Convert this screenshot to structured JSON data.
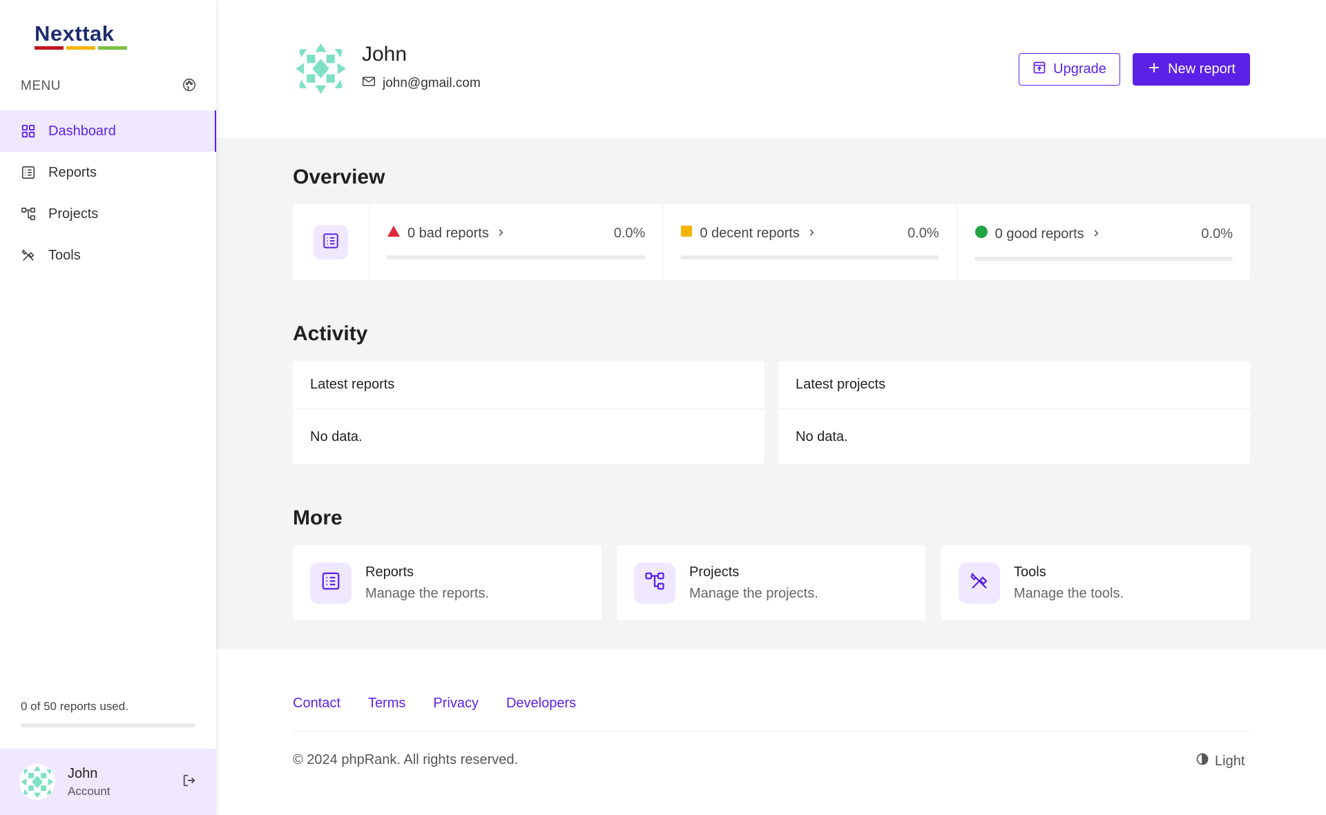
{
  "brand": {
    "logo_text": "Nexttak",
    "logo_colors": [
      "#c0161d",
      "#f1b400",
      "#7ac142"
    ]
  },
  "sidebar": {
    "menu_title": "MENU",
    "menu_icon": "palette-icon",
    "items": [
      {
        "label": "Dashboard",
        "icon": "grid-icon",
        "active": true
      },
      {
        "label": "Reports",
        "icon": "list-icon",
        "active": false
      },
      {
        "label": "Projects",
        "icon": "hierarchy-icon",
        "active": false
      },
      {
        "label": "Tools",
        "icon": "tools-icon",
        "active": false
      }
    ],
    "usage_text": "0 of 50 reports used.",
    "usage_fraction": 0,
    "account": {
      "name": "John",
      "sub": "Account",
      "logout_icon": "logout-icon"
    }
  },
  "header": {
    "name": "John",
    "email": "john@gmail.com",
    "upgrade_label": "Upgrade",
    "new_report_label": "New report"
  },
  "overview": {
    "title": "Overview",
    "stats": [
      {
        "label": "0 bad reports",
        "percent": "0.0%",
        "color": "#e0283a",
        "fraction": 0,
        "marker": "triangle"
      },
      {
        "label": "0 decent reports",
        "percent": "0.0%",
        "color": "#f4b400",
        "fraction": 0,
        "marker": "square"
      },
      {
        "label": "0 good reports",
        "percent": "0.0%",
        "color": "#22a344",
        "fraction": 0,
        "marker": "circle"
      }
    ]
  },
  "activity": {
    "title": "Activity",
    "latest_reports": {
      "title": "Latest reports",
      "body": "No data."
    },
    "latest_projects": {
      "title": "Latest projects",
      "body": "No data."
    }
  },
  "more": {
    "title": "More",
    "cards": [
      {
        "title": "Reports",
        "sub": "Manage the reports.",
        "icon": "list-icon"
      },
      {
        "title": "Projects",
        "sub": "Manage the projects.",
        "icon": "hierarchy-icon"
      },
      {
        "title": "Tools",
        "sub": "Manage the tools.",
        "icon": "tools-icon"
      }
    ]
  },
  "footer": {
    "links": [
      "Contact",
      "Terms",
      "Privacy",
      "Developers"
    ],
    "copyright": "© 2024 phpRank. All rights reserved.",
    "theme_label": "Light"
  },
  "colors": {
    "accent": "#5b21e6",
    "accent_light": "#efe8ff"
  }
}
